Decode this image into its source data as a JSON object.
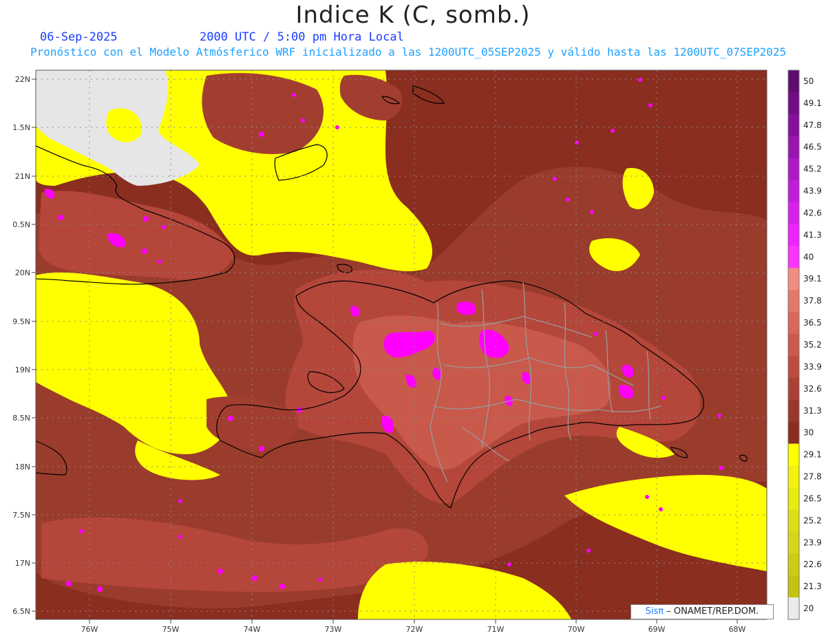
{
  "header": {
    "title": "Indice K (C, somb.)",
    "date": "06-Sep-2025",
    "time": "2000 UTC / 5:00 pm Hora Local",
    "subtitle": "Pronóstico con el Modelo Atmósferico WRF inicializado a las 1200UTC_05SEP2025 y válido hasta las  1200UTC_07SEP2025"
  },
  "map": {
    "lat_labels": [
      "22N",
      "1.5N",
      "21N",
      "0.5N",
      "20N",
      "9.5N",
      "19N",
      "8.5N",
      "18N",
      "7.5N",
      "17N",
      "6.5N"
    ],
    "lon_labels": [
      "76W",
      "75W",
      "74W",
      "73W",
      "72W",
      "71W",
      "70W",
      "69W",
      "68W"
    ],
    "grid": true,
    "no_data_color": "#e6e6e6"
  },
  "colorbar": {
    "labels": [
      "50",
      "49.1",
      "47.8",
      "46.5",
      "45.2",
      "43.9",
      "42.6",
      "41.3",
      "40",
      "39.1",
      "37.8",
      "36.5",
      "35.2",
      "33.9",
      "32.6",
      "31.3",
      "30",
      "29.1",
      "27.8",
      "26.5",
      "25.2",
      "23.9",
      "22.6",
      "21.3",
      "20"
    ],
    "colors": [
      "#5e0a6e",
      "#720c86",
      "#86109c",
      "#9a14b2",
      "#ae18c8",
      "#c41cdc",
      "#d820ee",
      "#ee24ff",
      "#ff33ff",
      "#f08d80",
      "#e4786a",
      "#d8685a",
      "#cb5a4c",
      "#bc4c3e",
      "#ac4034",
      "#9a362b",
      "#8a2e20",
      "#ffff00",
      "#f2f20c",
      "#e8ea10",
      "#dede14",
      "#d6d618",
      "#cccc12",
      "#c4c40e",
      "#ebebeb"
    ]
  },
  "credit": {
    "brand": "Sisπ",
    "org": "– ONAMET/REP.DOM."
  }
}
